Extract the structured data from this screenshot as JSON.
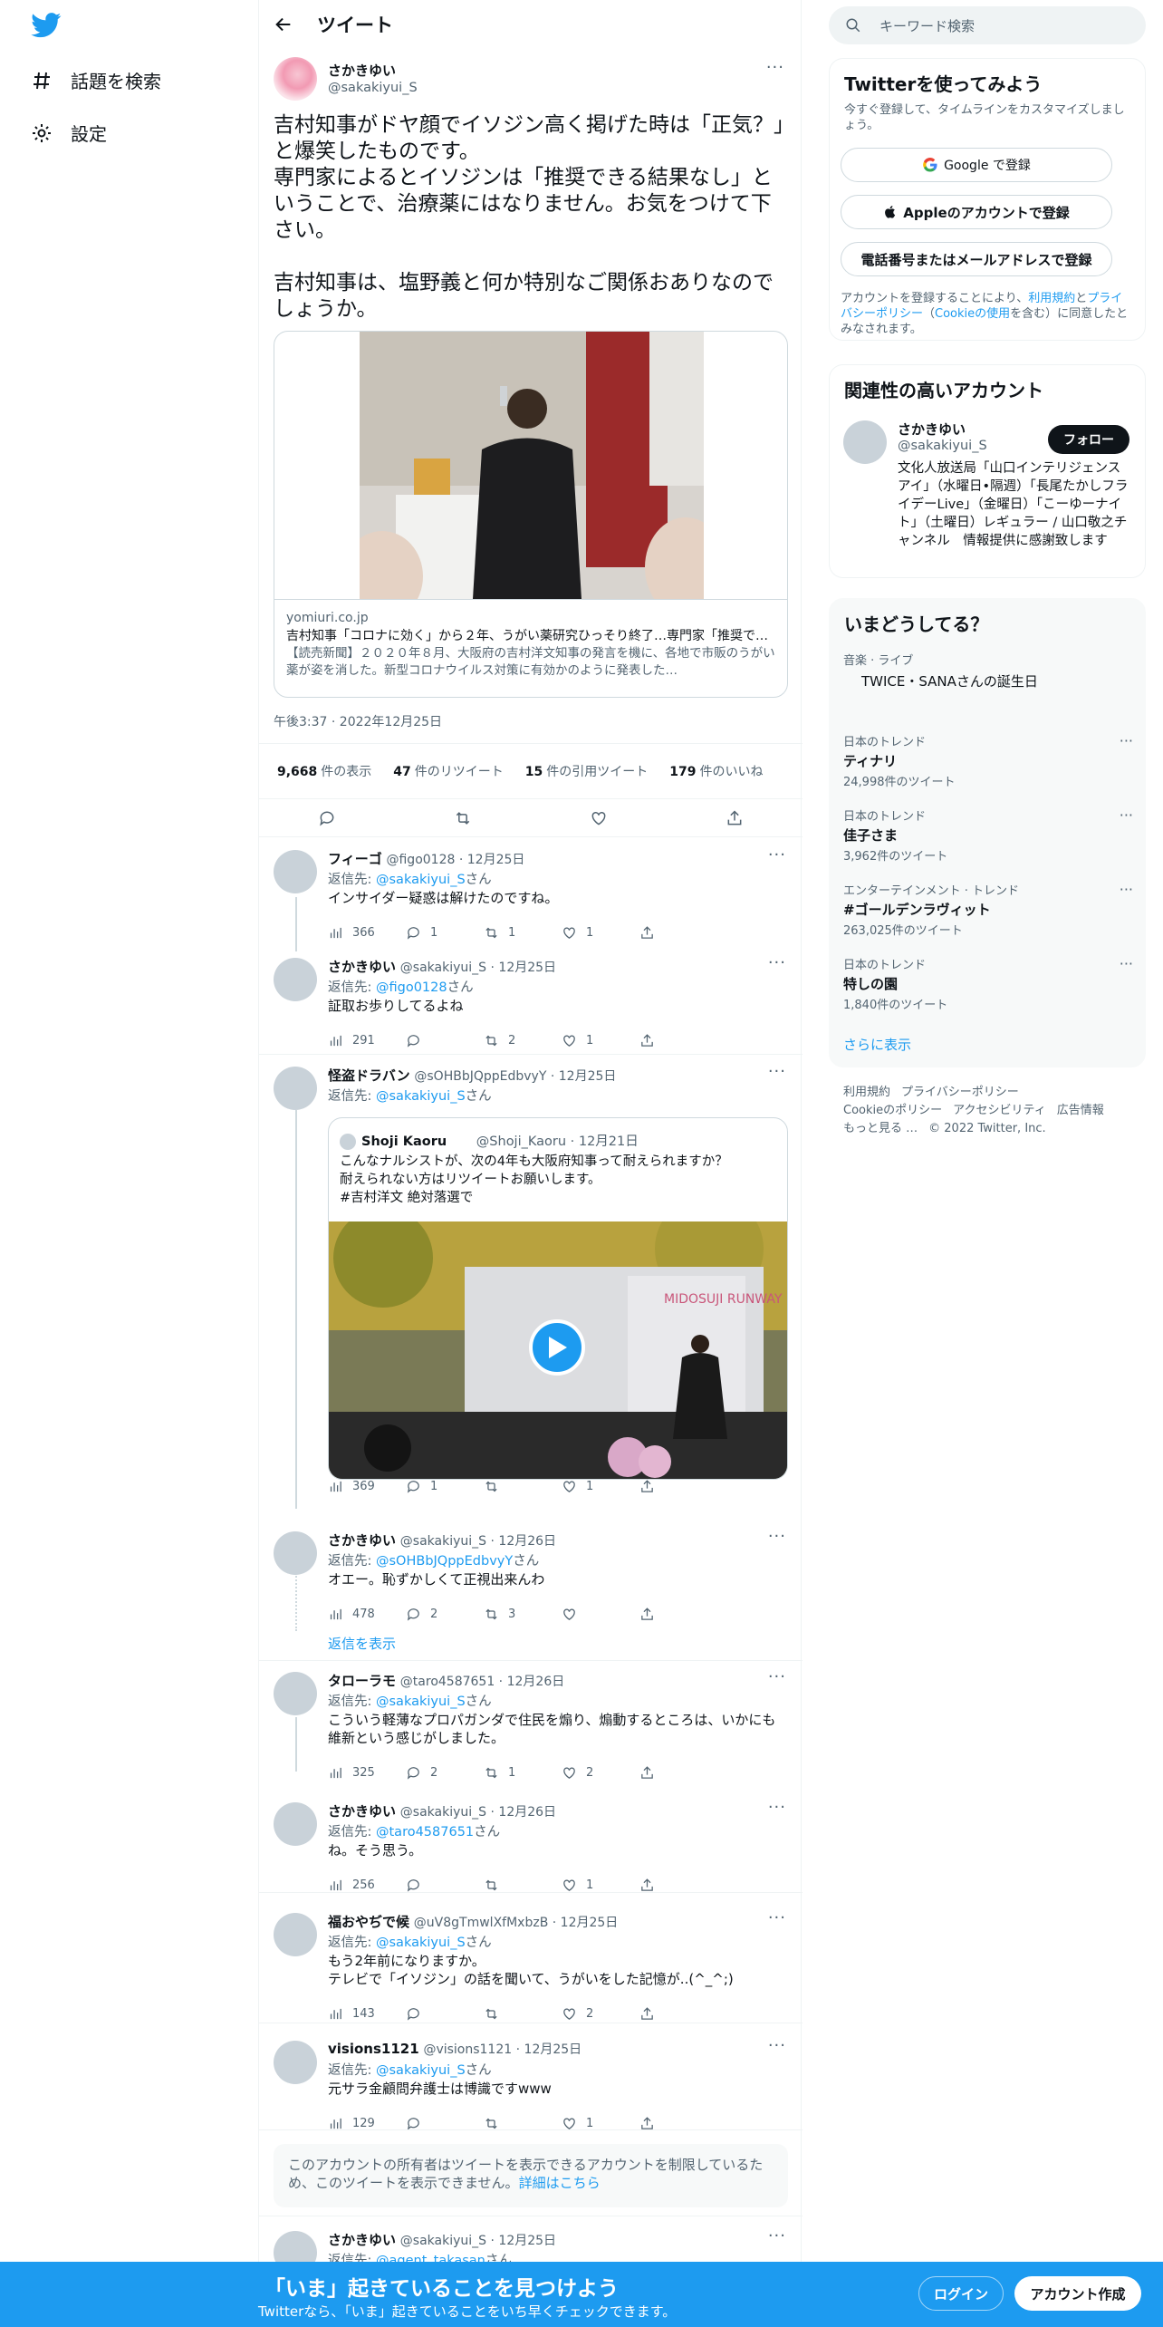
{
  "nav": {
    "explore": "話題を検索",
    "settings": "設定"
  },
  "header": {
    "title": "ツイート"
  },
  "tweet": {
    "display_name": "さかきゆい",
    "handle": "@sakakiyui_S",
    "text": "吉村知事がドヤ顔でイソジン高く掲げた時は「正気？」と爆笑したものです。\n専門家によるとイソジンは「推奨できる結果なし」ということで、治療薬にはなりません。お気をつけて下さい。\n\n吉村知事は、塩野義と何か特別なご関係おありなのでしょうか。",
    "card": {
      "domain": "yomiuri.co.jp",
      "title": "吉村知事「コロナに効く」から２年、うがい薬研究ひっそり終了…専門家「推奨できる結果なし」",
      "desc": "【読売新聞】２０２０年８月、大阪府の吉村洋文知事の発言を機に、各地で市販のうがい薬が姿を消した。新型コロナウイルス対策に有効かのように発表した…"
    },
    "timestamp": "午後3:37 · 2022年12月25日",
    "views": "9,668",
    "views_label": "件の表示",
    "retweets": "47",
    "retweets_label": "件のリツイート",
    "quotes": "15",
    "quotes_label": "件の引用ツイート",
    "likes": "179",
    "likes_label": "件のいいね"
  },
  "replies": [
    {
      "name": "フィーゴ",
      "handle": "@figo0128",
      "date": "12月25日",
      "reply_to": "@sakakiyui_S",
      "text": "インサイダー疑惑は解けたのですね。",
      "views": "366",
      "replies": "1",
      "retweets": "1",
      "likes": "1"
    },
    {
      "name": "さかきゆい",
      "handle": "@sakakiyui_S",
      "date": "12月25日",
      "reply_to": "@figo0128",
      "text": "証取お歩りしてるよね",
      "views": "291",
      "replies": "",
      "retweets": "2",
      "likes": "1"
    },
    {
      "name": "怪盗ドラバン",
      "handle": "@sOHBbJQppEdbvyY",
      "date": "12月25日",
      "reply_to": "@sakakiyui_S",
      "text": "",
      "views": "369",
      "replies": "1",
      "retweets": "",
      "likes": "1"
    },
    {
      "name": "さかきゆい",
      "handle": "@sakakiyui_S",
      "date": "12月26日",
      "reply_to": "@sOHBbJQppEdbvyY",
      "text": "オエー。恥ずかしくて正視出来んわ",
      "views": "478",
      "replies": "2",
      "retweets": "3",
      "likes": ""
    },
    {
      "name": "タローラモ",
      "handle": "@taro4587651",
      "date": "12月26日",
      "reply_to": "@sakakiyui_S",
      "text": "こういう軽薄なプロパガンダで住民を煽り、煽動するところは、いかにも維新という感じがしました。",
      "views": "325",
      "replies": "2",
      "retweets": "1",
      "likes": "2"
    },
    {
      "name": "さかきゆい",
      "handle": "@sakakiyui_S",
      "date": "12月26日",
      "reply_to": "@taro4587651",
      "text": "ね。そう思う。",
      "views": "256",
      "replies": "",
      "retweets": "",
      "likes": "1"
    },
    {
      "name": "福おやぢで候",
      "handle": "@uV8gTmwlXfMxbzB",
      "date": "12月25日",
      "reply_to": "@sakakiyui_S",
      "text": "もう2年前になりますか。\nテレビで「イソジン」の話を聞いて、うがいをした記憶が..(^_^;)",
      "views": "143",
      "replies": "",
      "retweets": "",
      "likes": "2"
    },
    {
      "name": "visions1121",
      "handle": "@visions1121",
      "date": "12月25日",
      "reply_to": "@sakakiyui_S",
      "text": "元サラ金顧問弁護士は博識ですwww",
      "views": "129",
      "replies": "",
      "retweets": "",
      "likes": "1"
    },
    {
      "name": "さかきゆい",
      "handle": "@sakakiyui_S",
      "date": "12月25日",
      "reply_to": "@agent_takasan",
      "text": "",
      "views": "",
      "replies": "",
      "retweets": "",
      "likes": ""
    }
  ],
  "reply_prefix": "返信先: ",
  "reply_suffix": "さん",
  "quote": {
    "name": "Shoji Kaoru",
    "handle": "@Shoji_Kaoru",
    "date": "12月21日",
    "text": "こんなナルシストが、次の4年も大阪府知事って耐えられますか？\n耐えられない方はリツイートお願いします。\n#吉村洋文 絶対落選で",
    "video_sign": "MIDOSUJI RUNWAY"
  },
  "show_replies": "返信を表示",
  "restricted": {
    "text": "このアカウントの所有者はツイートを表示できるアカウントを制限しているため、このツイートを表示できません。",
    "link": "詳細はこちら"
  },
  "sidebar": {
    "search_placeholder": "キーワード検索",
    "signup": {
      "title": "Twitterを使ってみよう",
      "subtitle": "今すぐ登録して、タイムラインをカスタマイズしましょう。",
      "google": "Google で登録",
      "apple": "Appleのアカウントで登録",
      "phone": "電話番号またはメールアドレスで登録",
      "terms_pre": "アカウントを登録することにより、",
      "terms": "利用規約",
      "and": "と",
      "privacy": "プライバシーポリシー",
      "cookie": "Cookieの使用",
      "terms_post": "を含む）に同意したとみなされます。"
    },
    "related": {
      "title": "関連性の高いアカウント",
      "name": "さかきゆい",
      "handle": "@sakakiyui_S",
      "follow": "フォロー",
      "bio": "文化人放送局「山口インテリジェンスアイ」（水曜日•隔週）「長尾たかしフライデーLive」（金曜日）「こーゆーナイト」（土曜日）レギュラー / 山口敬之チャンネル　情報提供に感謝致します"
    },
    "trends": {
      "title": "いまどうしてる？",
      "music_cat": "音楽 · ライブ",
      "music_name": "TWICE・SANAさんの誕生日",
      "items": [
        {
          "cat": "日本のトレンド",
          "name": "ティナリ",
          "count": "24,998件のツイート"
        },
        {
          "cat": "日本のトレンド",
          "name": "佳子さま",
          "count": "3,962件のツイート"
        },
        {
          "cat": "エンターテインメント · トレンド",
          "name": "#ゴールデンラヴィット",
          "count": "263,025件のツイート"
        },
        {
          "cat": "日本のトレンド",
          "name": "特しの園",
          "count": "1,840件のツイート"
        }
      ],
      "more": "さらに表示"
    },
    "footer": {
      "l1": "利用規約",
      "l2": "プライバシーポリシー",
      "l3": "Cookieのポリシー",
      "l4": "アクセシビリティ",
      "l5": "広告情報",
      "l6": "もっと見る …",
      "copy": "© 2022 Twitter, Inc."
    }
  },
  "bottom": {
    "headline": "「いま」起きていることを見つけよう",
    "sub": "Twitterなら、「いま」起きていることをいち早くチェックできます。",
    "login": "ログイン",
    "signup": "アカウント作成"
  },
  "colors": {
    "accent": "#1d9bf0",
    "text": "#0f1419",
    "muted": "#536471"
  }
}
